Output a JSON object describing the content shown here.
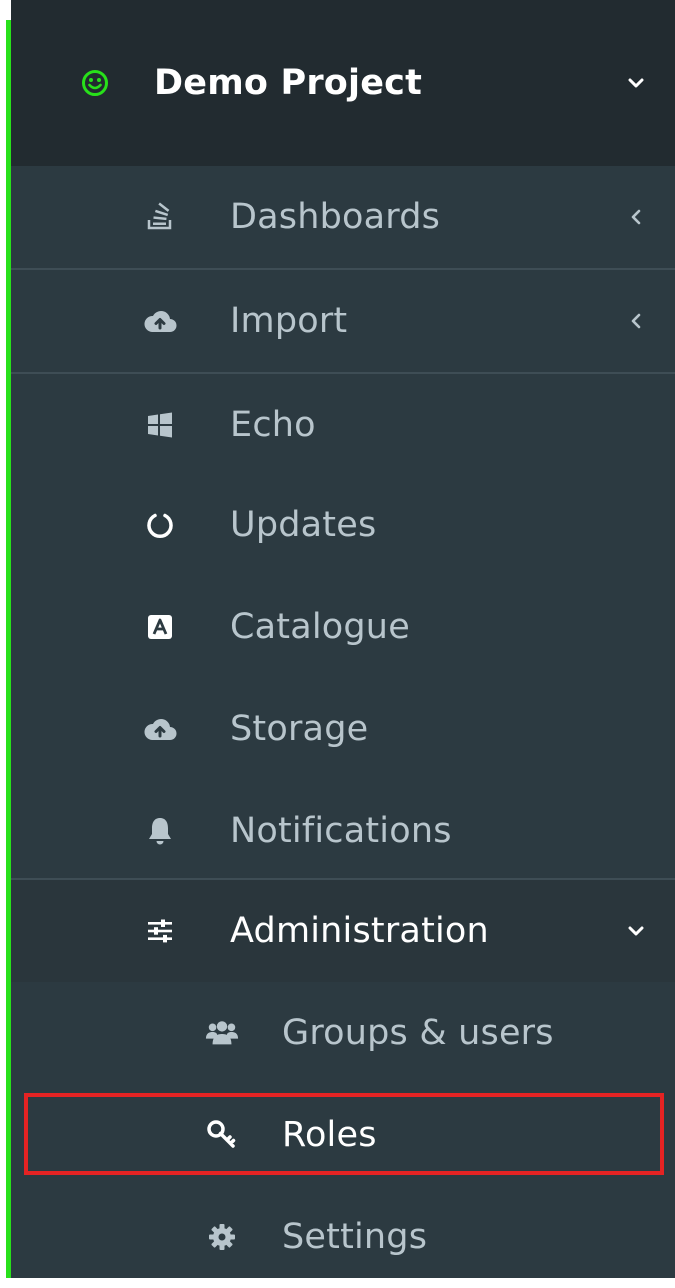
{
  "project": {
    "name": "Demo Project",
    "icon": "smiley-icon",
    "accent": "#28e01a"
  },
  "nav": {
    "items": [
      {
        "label": "Dashboards",
        "icon": "stack-icon",
        "chevron": "chevron-left-icon"
      },
      {
        "label": "Import",
        "icon": "cloud-upload-icon",
        "chevron": "chevron-left-icon"
      },
      {
        "label": "Echo",
        "icon": "windows-icon"
      },
      {
        "label": "Updates",
        "icon": "circle-notch-icon"
      },
      {
        "label": "Catalogue",
        "icon": "catalogue-a-icon"
      },
      {
        "label": "Storage",
        "icon": "cloud-upload-icon"
      },
      {
        "label": "Notifications",
        "icon": "bell-icon"
      },
      {
        "label": "Administration",
        "icon": "sliders-icon",
        "chevron": "chevron-down-icon",
        "expanded": true
      }
    ]
  },
  "admin_submenu": {
    "items": [
      {
        "label": "Groups & users",
        "icon": "users-icon"
      },
      {
        "label": "Roles",
        "icon": "key-icon",
        "highlighted": true
      },
      {
        "label": "Settings",
        "icon": "gear-icon"
      }
    ]
  },
  "colors": {
    "sidebar_bg": "#2c3a41",
    "header_bg": "#222b30",
    "highlight_border": "#e52323"
  }
}
